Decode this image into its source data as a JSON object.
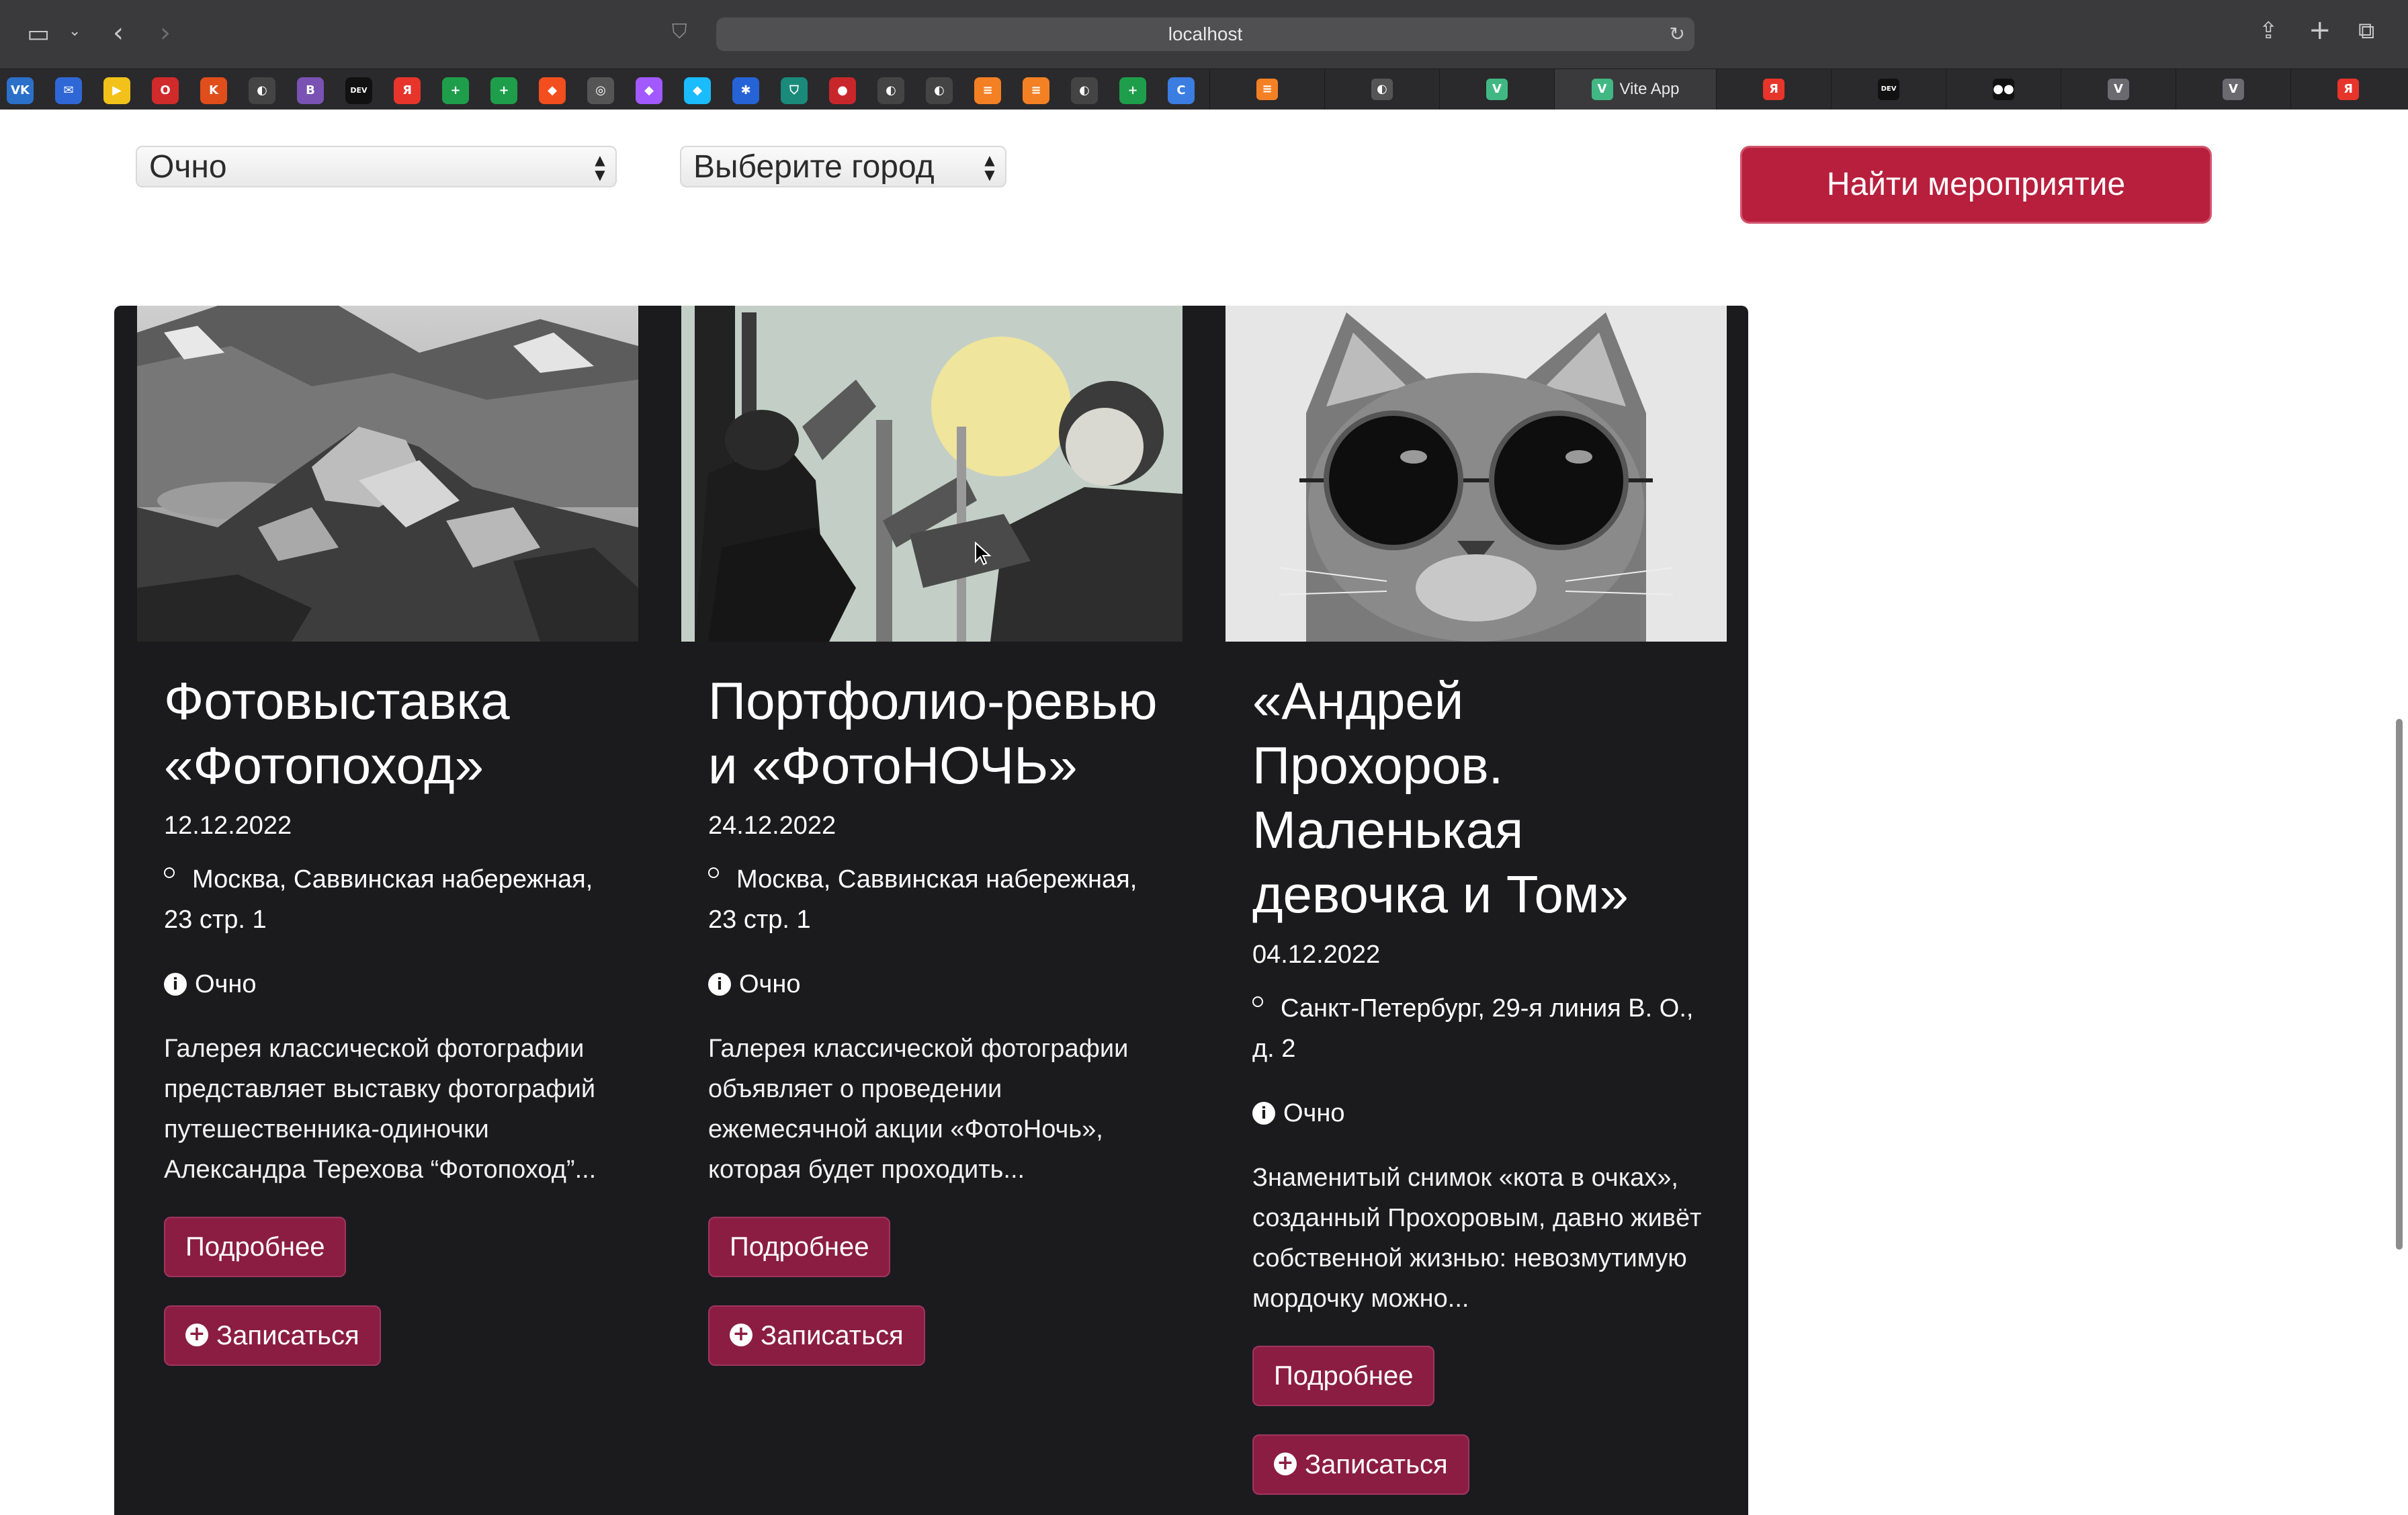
{
  "browser": {
    "url": "localhost",
    "favorites": [
      {
        "icon": "vk-icon",
        "glyph": "VK",
        "color": "#2b70c9"
      },
      {
        "icon": "mail-icon",
        "glyph": "✉",
        "color": "#2f68d6"
      },
      {
        "icon": "play-icon",
        "glyph": "▶",
        "color": "#f2c21a"
      },
      {
        "icon": "opera-icon",
        "glyph": "O",
        "color": "#d12a2a"
      },
      {
        "icon": "figma-k-icon",
        "glyph": "K",
        "color": "#e04e1b"
      },
      {
        "icon": "github-icon",
        "glyph": "◐",
        "color": "#444"
      },
      {
        "icon": "bootstrap-icon",
        "glyph": "B",
        "color": "#7952b3"
      },
      {
        "icon": "dev-icon",
        "glyph": "DEV",
        "color": "#111"
      },
      {
        "icon": "yandex-icon",
        "glyph": "Я",
        "color": "#e7352b"
      },
      {
        "icon": "sheets-icon",
        "glyph": "+",
        "color": "#1e9e4a"
      },
      {
        "icon": "sheets-icon",
        "glyph": "+",
        "color": "#1e9e4a"
      },
      {
        "icon": "figma-icon",
        "glyph": "◆",
        "color": "#f24e1e"
      },
      {
        "icon": "chatgpt-icon",
        "glyph": "◎",
        "color": "#555"
      },
      {
        "icon": "figma-icon",
        "glyph": "◆",
        "color": "#a259ff"
      },
      {
        "icon": "figma-icon",
        "glyph": "◆",
        "color": "#1abcfe"
      },
      {
        "icon": "jira-icon",
        "glyph": "✱",
        "color": "#2663d6"
      },
      {
        "icon": "shield-icon",
        "glyph": "⛉",
        "color": "#1a8a7a"
      },
      {
        "icon": "flame-icon",
        "glyph": "●",
        "color": "#c9262c"
      },
      {
        "icon": "github-icon",
        "glyph": "◐",
        "color": "#444"
      },
      {
        "icon": "github-icon",
        "glyph": "◐",
        "color": "#444"
      },
      {
        "icon": "stack-icon",
        "glyph": "≡",
        "color": "#f48024"
      },
      {
        "icon": "stack-icon",
        "glyph": "≡",
        "color": "#f48024"
      },
      {
        "icon": "github-icon",
        "glyph": "◐",
        "color": "#444"
      },
      {
        "icon": "sheets-icon",
        "glyph": "+",
        "color": "#1e9e4a"
      },
      {
        "icon": "chrome-icon",
        "glyph": "C",
        "color": "#3b7de0"
      }
    ],
    "tabs": [
      {
        "icon": "stack-icon",
        "glyph": "≡",
        "color": "#f48024",
        "label": ""
      },
      {
        "icon": "github-icon",
        "glyph": "◐",
        "color": "#555",
        "label": ""
      },
      {
        "icon": "vue-icon",
        "glyph": "V",
        "color": "#41b883",
        "label": ""
      },
      {
        "icon": "vue-icon",
        "glyph": "V",
        "color": "#41b883",
        "label": "Vite App",
        "active": true
      },
      {
        "icon": "yandex-icon",
        "glyph": "Я",
        "color": "#e7352b",
        "label": ""
      },
      {
        "icon": "dev-icon",
        "glyph": "DEV",
        "color": "#111",
        "label": ""
      },
      {
        "icon": "medium-icon",
        "glyph": "●●",
        "color": "#111",
        "label": ""
      },
      {
        "icon": "v-icon",
        "glyph": "V",
        "color": "#6a6a70",
        "label": ""
      },
      {
        "icon": "v-icon",
        "glyph": "V",
        "color": "#6a6a70",
        "label": ""
      },
      {
        "icon": "yandex-icon",
        "glyph": "Я",
        "color": "#e7352b",
        "label": ""
      }
    ]
  },
  "filters": {
    "format_select": "Очно",
    "city_select": "Выберите город",
    "find_button": "Найти мероприятие"
  },
  "events": [
    {
      "title": "Фотовыставка «Фотопоход»",
      "date": "12.12.2022",
      "location": "Москва, Саввинская набережная, 23 стр. 1",
      "mode": "Очно",
      "description": "Галерея классической фотографии представляет выставку фотографий путешественника-одиночки Александра Терехова “Фотопоход”...",
      "more_label": "Подробнее",
      "signup_label": "Записаться"
    },
    {
      "title": "Портфолио-ревью и «ФотоНОЧЬ»",
      "date": "24.12.2022",
      "location": "Москва, Саввинская набережная, 23 стр. 1",
      "mode": "Очно",
      "description": "Галерея классической фотографии объявляет о проведении ежемесячной акции «ФотоНочь», которая будет проходить...",
      "more_label": "Подробнее",
      "signup_label": "Записаться"
    },
    {
      "title": "«Андрей Прохоров. Маленькая девочка и Том»",
      "date": "04.12.2022",
      "location": "Санкт-Петербург, 29-я линия В. О., д. 2",
      "mode": "Очно",
      "description": "Знаменитый снимок «кота в очках», созданный Прохоровым, давно живёт собственной жизнью: невозмутимую мордочку можно...",
      "more_label": "Подробнее",
      "signup_label": "Записаться"
    }
  ]
}
